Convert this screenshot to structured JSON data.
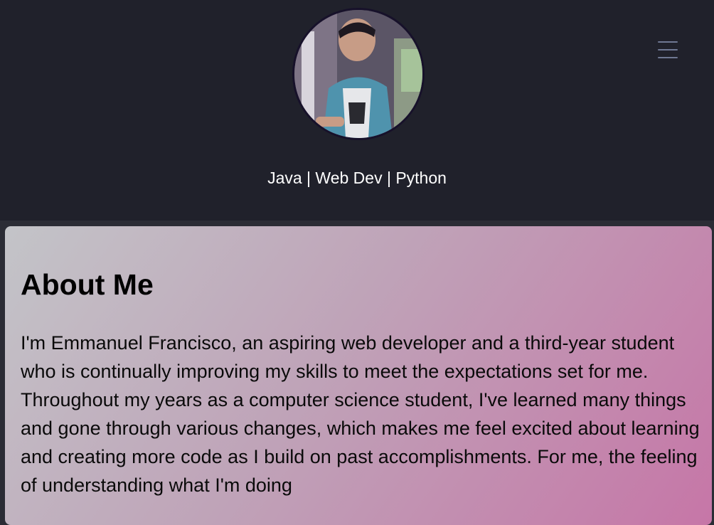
{
  "header": {
    "tagline": "Java | Web Dev | Python"
  },
  "about": {
    "title": "About Me",
    "paragraph": "I'm Emmanuel Francisco, an aspiring web developer and a third-year student who is continually improving my skills to meet the expectations set for me. Throughout my years as a computer science student, I've learned many things and gone through various changes, which makes me feel excited about learning and creating more code as I build on past accomplishments. For me, the feeling of understanding what I'm doing"
  },
  "icons": {
    "menu": "hamburger-menu-icon",
    "avatar": "profile-photo"
  },
  "colors": {
    "header_bg": "#20212b",
    "menu_icon": "#6f7893",
    "card_gradient_start": "#c3c4c8",
    "card_gradient_end": "#c676a7"
  }
}
